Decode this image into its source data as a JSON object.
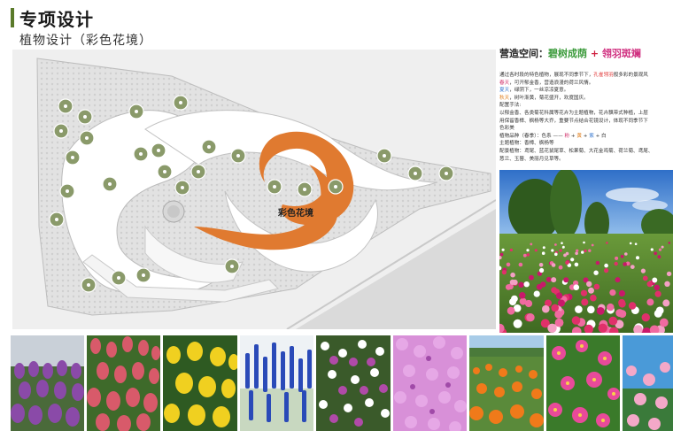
{
  "header": {
    "title": "专项设计",
    "subtitle": "植物设计（彩色花境）"
  },
  "plan": {
    "label": "彩色花境"
  },
  "caption": {
    "lead": "营造空间：",
    "theme_a": "碧树成荫",
    "plus": " + ",
    "theme_b": "翎羽斑斓",
    "lines": [
      {
        "parts": [
          [
            "通过各时段的特色植物，展现不同季节下，",
            ""
          ],
          [
            "孔雀翎羽",
            "hl"
          ],
          [
            "般多彩的景观风",
            ""
          ]
        ]
      },
      {
        "parts": [
          [
            "春天",
            "spring"
          ],
          [
            "，可开郁金香，营造浪漫的荷兰风情。",
            ""
          ]
        ]
      },
      {
        "parts": [
          [
            "夏天",
            "summer"
          ],
          [
            "，绿阴下，一丝凉凉夏意。",
            ""
          ]
        ]
      },
      {
        "parts": [
          [
            "秋天",
            "autumn"
          ],
          [
            "，树叶渐黄，菊花盛开，欢度国庆。",
            ""
          ]
        ]
      },
      {
        "parts": [
          [
            "配置手法:",
            ""
          ]
        ]
      },
      {
        "parts": [
          [
            "以郁金香、各类菊花科属等花卉为主题植物，花卉飘带式种植，上层",
            ""
          ]
        ]
      },
      {
        "parts": [
          [
            "用保留香樟、枫杨等大乔，重要节点结合花镜设计，体现不同季节下",
            ""
          ]
        ]
      },
      {
        "parts": [
          [
            "色彩美",
            ""
          ]
        ]
      },
      {
        "parts": [
          [
            "植物品种（春季）：色系 ——  ",
            ""
          ],
          [
            "粉",
            "spring"
          ],
          [
            " + ",
            ""
          ],
          [
            "黄",
            "autumn"
          ],
          [
            " + ",
            ""
          ],
          [
            "紫",
            "summer"
          ],
          [
            " + 白",
            ""
          ]
        ]
      },
      {
        "parts": [
          [
            "主题植物：香樟、枫杨等",
            ""
          ]
        ]
      },
      {
        "parts": [
          [
            "配景植物：鸢尾、蓝花鼠尾草、松果菊、大花金鸡菊、荷兰菊、鸢尾、",
            ""
          ]
        ]
      },
      {
        "parts": [
          [
            "葱兰、玉簪、美丽月见草等。",
            ""
          ]
        ]
      }
    ]
  },
  "colors": {
    "accent_bar": "#5a7a2a",
    "flower_band": "#e07a30",
    "tree_symbol": "#8a9a6a",
    "theme_green": "#3a9a3a",
    "theme_pink": "#d03080"
  },
  "photos": {
    "main": "cosmos-meadow-photo",
    "strip": [
      "purple-tulip-photo",
      "pink-tulip-photo",
      "yellow-tulip-photo",
      "blue-salvia-photo",
      "phlox-white-purple-photo",
      "pink-phlox-photo",
      "orange-calendula-field-photo",
      "pink-flower-photo",
      "pink-blossom-sky-photo"
    ]
  }
}
